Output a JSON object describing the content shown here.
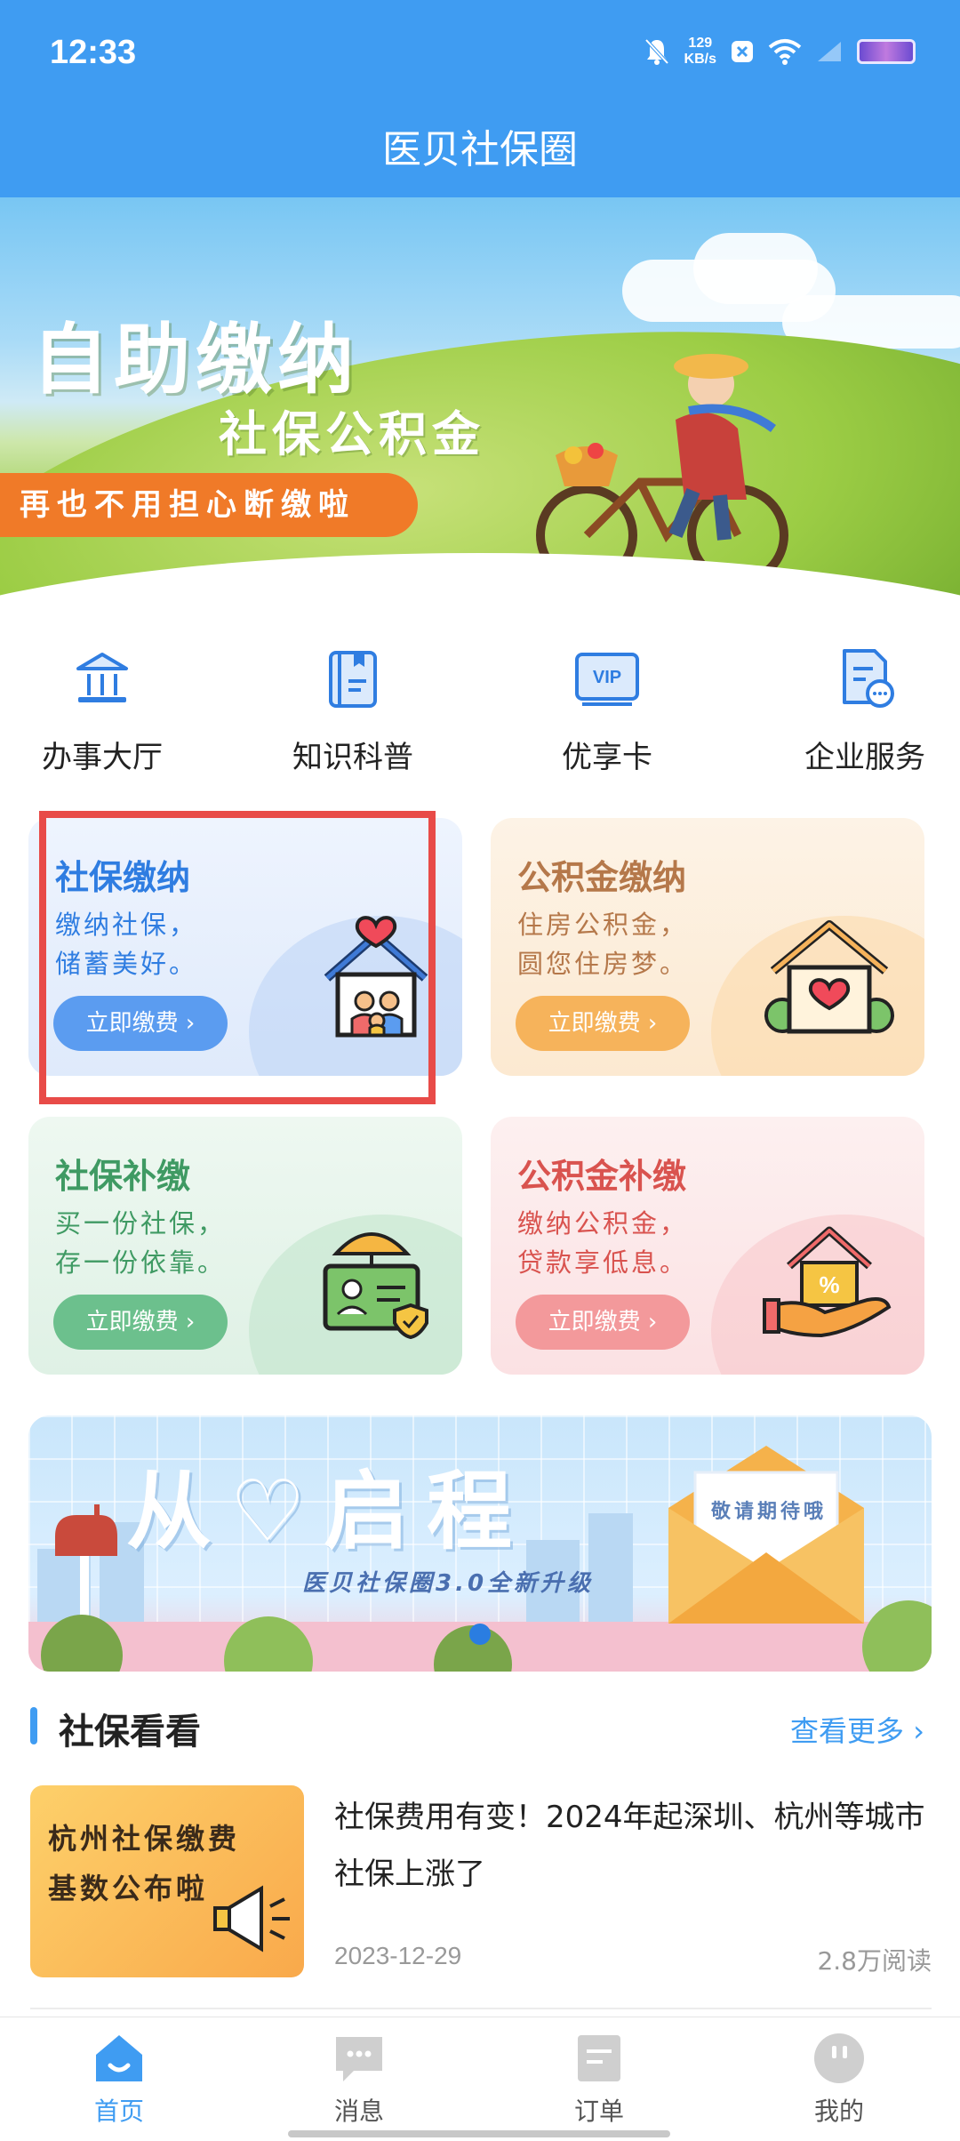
{
  "status_bar": {
    "time": "12:33",
    "net_speed_value": "129",
    "net_speed_unit": "KB/s"
  },
  "header": {
    "title": "医贝社保圈"
  },
  "hero": {
    "title": "自助缴纳",
    "subtitle": "社保公积金",
    "tag": "再也不用担心断缴啦"
  },
  "menu": [
    {
      "label": "办事大厅",
      "icon": "hall-icon"
    },
    {
      "label": "知识科普",
      "icon": "book-icon"
    },
    {
      "label": "优享卡",
      "icon": "vip-card-icon"
    },
    {
      "label": "企业服务",
      "icon": "enterprise-doc-icon"
    }
  ],
  "cards": [
    {
      "title": "社保缴纳",
      "desc1": "缴纳社保，",
      "desc2": "储蓄美好。",
      "button": "立即缴费 ›",
      "color": "#2f7de1",
      "btn_color": "#5b9cf0"
    },
    {
      "title": "公积金缴纳",
      "desc1": "住房公积金，",
      "desc2": "圆您住房梦。",
      "button": "立即缴费 ›",
      "color": "#b5784a",
      "btn_color": "#f6b35b"
    },
    {
      "title": "社保补缴",
      "desc1": "买一份社保，",
      "desc2": "存一份依靠。",
      "button": "立即缴费 ›",
      "color": "#3f9a63",
      "btn_color": "#6cc08d"
    },
    {
      "title": "公积金补缴",
      "desc1": "缴纳公积金，",
      "desc2": "贷款享低息。",
      "button": "立即缴费 ›",
      "color": "#d9534f",
      "btn_color": "#f3999b"
    }
  ],
  "promo": {
    "title": "从♡启程",
    "subtitle": "医贝社保圈3.0全新升级",
    "note": "敬请期待哦"
  },
  "news_section": {
    "title": "社保看看",
    "more": "查看更多"
  },
  "news": [
    {
      "thumb_line1": "杭州社保缴费",
      "thumb_line2": "基数公布啦",
      "title": "社保费用有变！2024年起深圳、杭州等城市社保上涨了",
      "date": "2023-12-29",
      "reads": "2.8万阅读"
    }
  ],
  "bottom_nav": [
    {
      "label": "首页",
      "icon": "home-icon",
      "active": true
    },
    {
      "label": "消息",
      "icon": "message-icon",
      "active": false
    },
    {
      "label": "订单",
      "icon": "order-icon",
      "active": false
    },
    {
      "label": "我的",
      "icon": "profile-icon",
      "active": false
    }
  ],
  "colors": {
    "primary": "#3f9cf2",
    "highlight_border": "#e84b48"
  }
}
